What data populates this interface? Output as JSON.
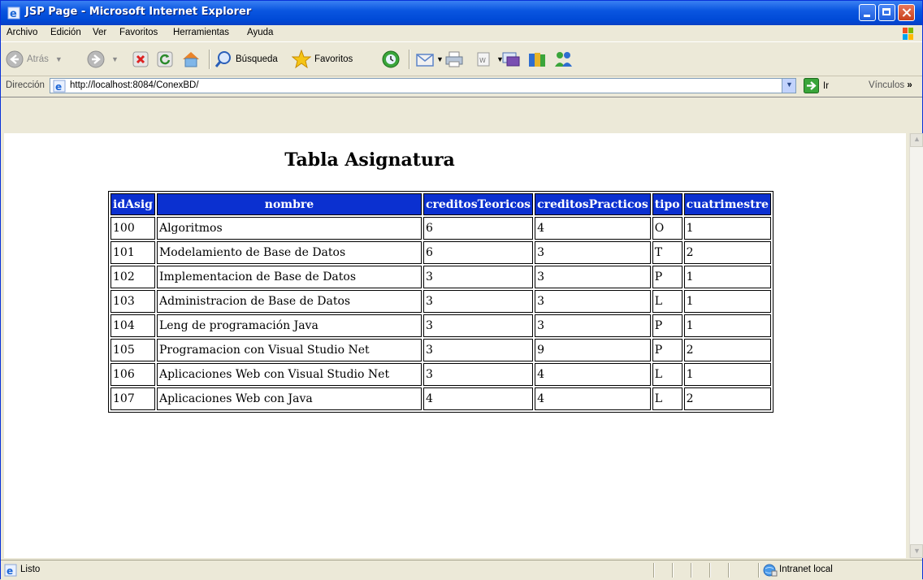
{
  "window": {
    "title": "JSP Page - Microsoft Internet Explorer"
  },
  "menu": [
    "Archivo",
    "Edición",
    "Ver",
    "Favoritos",
    "Herramientas",
    "Ayuda"
  ],
  "toolbar": {
    "back_label": "Atrás",
    "search_label": "Búsqueda",
    "favorites_label": "Favoritos"
  },
  "address": {
    "label": "Dirección",
    "url": "http://localhost:8084/ConexBD/",
    "go_label": "Ir",
    "links_label": "Vínculos"
  },
  "page": {
    "title": "Tabla Asignatura",
    "headers": [
      "idAsig",
      "nombre",
      "creditosTeoricos",
      "creditosPracticos",
      "tipo",
      "cuatrimestre"
    ],
    "rows": [
      [
        "100",
        "Algoritmos",
        "6",
        "4",
        "O",
        "1"
      ],
      [
        "101",
        "Modelamiento de Base de Datos",
        "6",
        "3",
        "T",
        "2"
      ],
      [
        "102",
        "Implementacion de Base de Datos",
        "3",
        "3",
        "P",
        "1"
      ],
      [
        "103",
        "Administracion de Base de Datos",
        "3",
        "3",
        "L",
        "1"
      ],
      [
        "104",
        "Leng de programación Java",
        "3",
        "3",
        "P",
        "1"
      ],
      [
        "105",
        "Programacion con Visual Studio Net",
        "3",
        "9",
        "P",
        "2"
      ],
      [
        "106",
        "Aplicaciones Web con Visual Studio Net",
        "3",
        "4",
        "L",
        "1"
      ],
      [
        "107",
        "Aplicaciones Web con Java",
        "4",
        "4",
        "L",
        "2"
      ]
    ]
  },
  "status": {
    "text": "Listo",
    "zone": "Intranet local"
  },
  "colors": {
    "header_bg": "#0b30d0",
    "titlebar": "#0a56e0"
  }
}
